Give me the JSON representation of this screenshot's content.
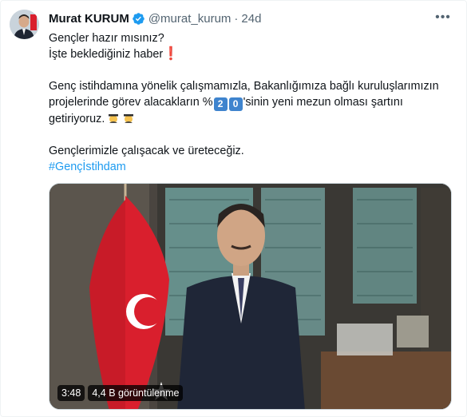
{
  "author": {
    "name": "Murat KURUM",
    "handle": "@murat_kurum",
    "separator": "·",
    "time": "24d",
    "verified": true,
    "avatar": "avatar-photo"
  },
  "tweet": {
    "line1": "Gençler hazır mısınız?",
    "line2": "İşte beklediğiniz haber",
    "line2_emoji": "❗",
    "para2_start": "Genç istihdamına yönelik çalışmamızla, Bakanlığımıza bağlı kuruluşlarımızın projelerinde görev alacakların %",
    "key1": "2",
    "key2": "0",
    "para2_end": "'sinin yeni mezun olması şartını getiriyoruz.",
    "line3": "Gençlerimizle çalışacak ve üreteceğiz.",
    "hashtag": "#Gençİstihdam"
  },
  "video": {
    "duration": "3:48",
    "views": "4,4 B görüntülenme"
  },
  "colors": {
    "link": "#1d9bf0",
    "verified": "#1d9bf0",
    "secondary_text": "#536471",
    "flag_red": "#d91f2d"
  }
}
